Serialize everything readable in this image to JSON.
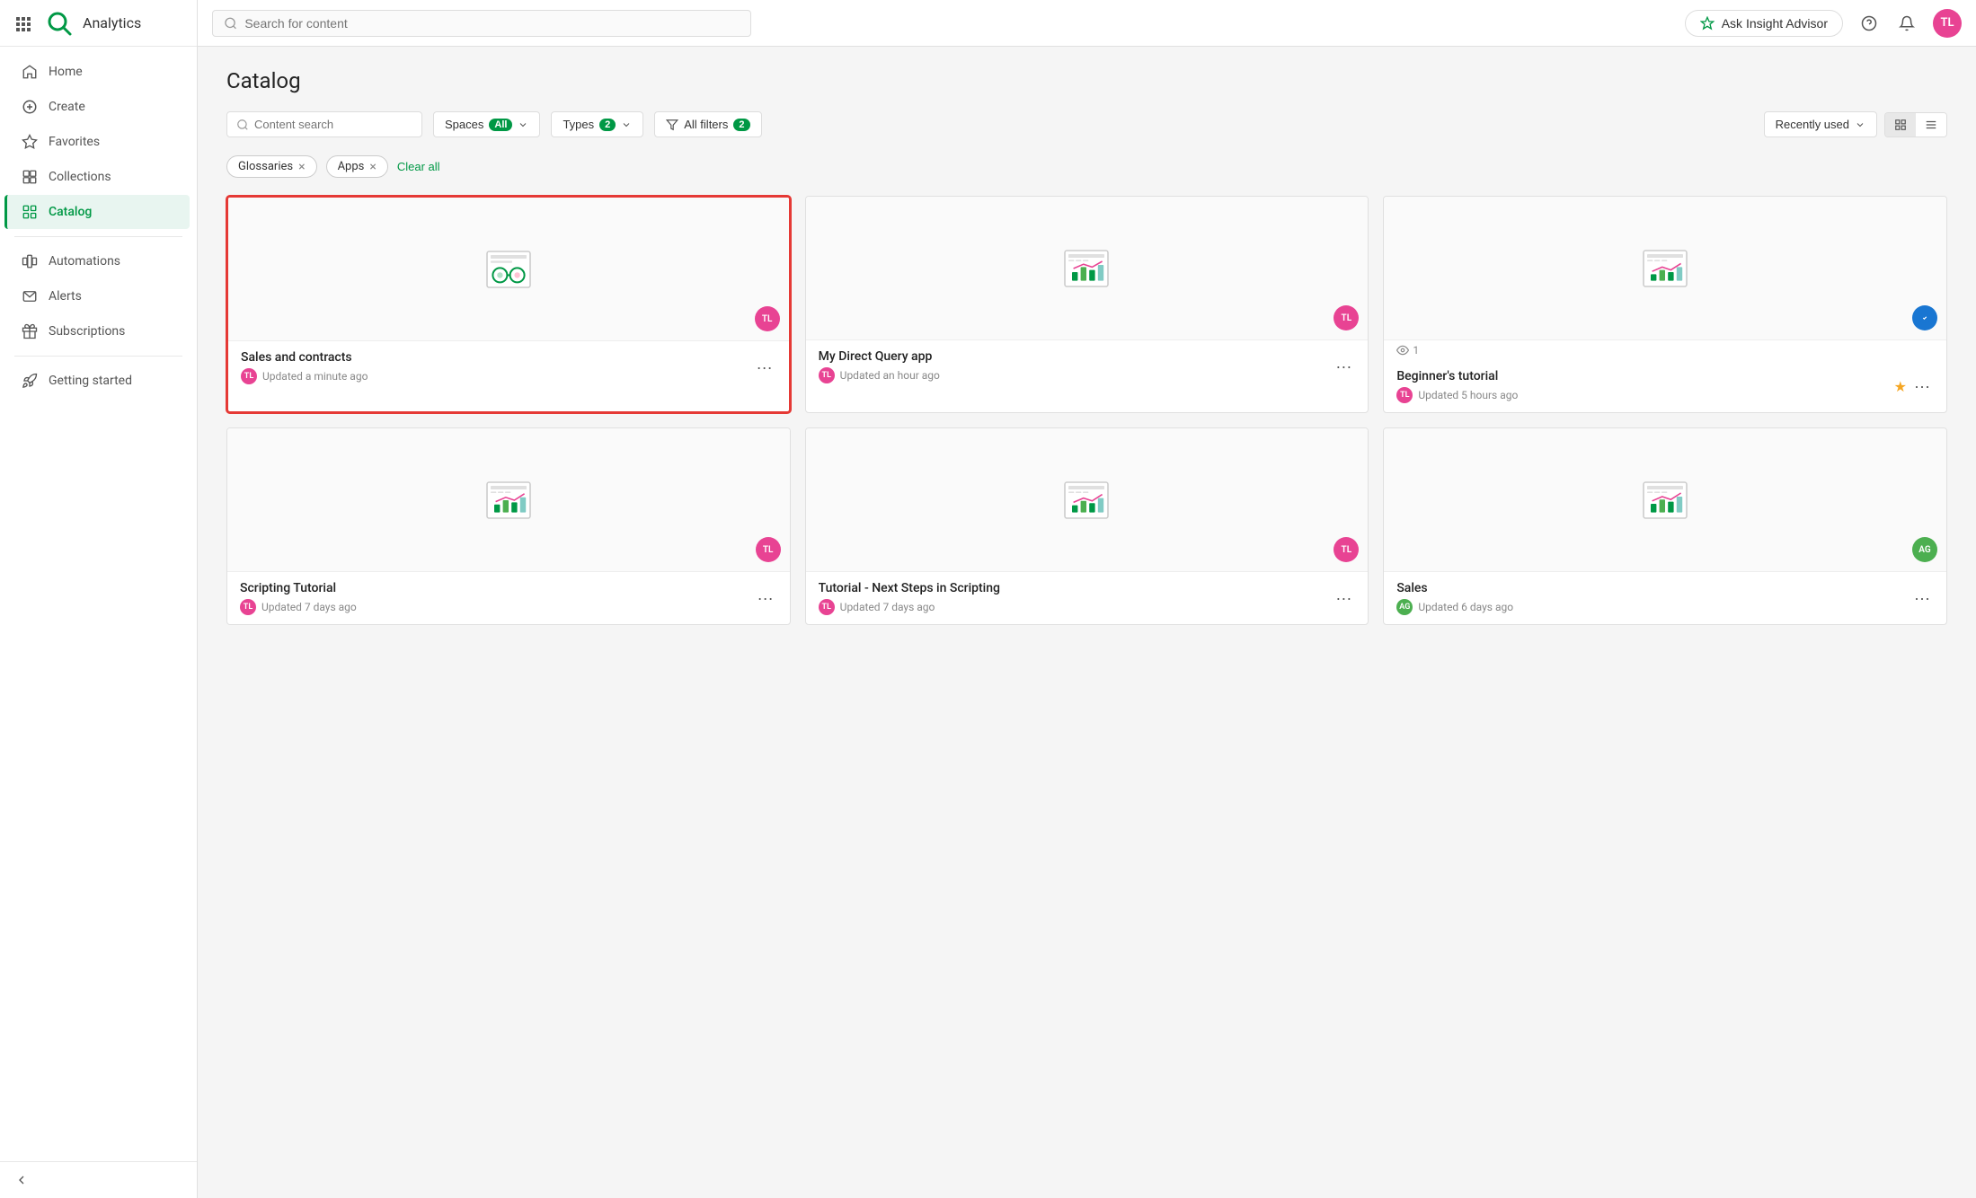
{
  "app": {
    "name": "Analytics",
    "logo_alt": "Qlik"
  },
  "topbar": {
    "search_placeholder": "Search for content",
    "insight_btn": "Ask Insight Advisor",
    "avatar_initials": "TL"
  },
  "sidebar": {
    "items": [
      {
        "id": "home",
        "label": "Home",
        "icon": "home"
      },
      {
        "id": "create",
        "label": "Create",
        "icon": "plus"
      },
      {
        "id": "favorites",
        "label": "Favorites",
        "icon": "star"
      },
      {
        "id": "collections",
        "label": "Collections",
        "icon": "collections"
      },
      {
        "id": "catalog",
        "label": "Catalog",
        "icon": "catalog",
        "active": true
      },
      {
        "id": "automations",
        "label": "Automations",
        "icon": "automations"
      },
      {
        "id": "alerts",
        "label": "Alerts",
        "icon": "alerts"
      },
      {
        "id": "subscriptions",
        "label": "Subscriptions",
        "icon": "subscriptions"
      },
      {
        "id": "getting-started",
        "label": "Getting started",
        "icon": "rocket"
      }
    ],
    "collapse_label": "Collapse"
  },
  "catalog": {
    "title": "Catalog",
    "content_search_placeholder": "Content search",
    "spaces_btn": "Spaces",
    "spaces_value": "All",
    "types_btn": "Types",
    "types_count": 2,
    "all_filters_btn": "All filters",
    "all_filters_count": 2,
    "sort_label": "Recently used",
    "active_chips": [
      {
        "label": "Glossaries",
        "id": "glossaries"
      },
      {
        "label": "Apps",
        "id": "apps"
      }
    ],
    "clear_all": "Clear all",
    "cards": [
      {
        "id": "sales-contracts",
        "title": "Sales and contracts",
        "meta": "Updated a minute ago",
        "avatar": "TL",
        "avatar_type": "tl",
        "icon": "glossary",
        "highlighted": true,
        "views": null,
        "starred": false
      },
      {
        "id": "my-direct-query",
        "title": "My Direct Query app",
        "meta": "Updated an hour ago",
        "avatar": "TL",
        "avatar_type": "tl",
        "icon": "app",
        "highlighted": false,
        "views": null,
        "starred": false
      },
      {
        "id": "beginners-tutorial",
        "title": "Beginner's tutorial",
        "meta": "Updated 5 hours ago",
        "avatar": "TL",
        "avatar_type": "tl",
        "icon": "app",
        "highlighted": false,
        "views": 1,
        "starred": true,
        "badge_type": "blue"
      },
      {
        "id": "scripting-tutorial",
        "title": "Scripting Tutorial",
        "meta": "Updated 7 days ago",
        "avatar": "TL",
        "avatar_type": "tl",
        "icon": "app",
        "highlighted": false,
        "views": null,
        "starred": false
      },
      {
        "id": "tutorial-next-steps",
        "title": "Tutorial - Next Steps in Scripting",
        "meta": "Updated 7 days ago",
        "avatar": "TL",
        "avatar_type": "tl",
        "icon": "app",
        "highlighted": false,
        "views": null,
        "starred": false
      },
      {
        "id": "sales",
        "title": "Sales",
        "meta": "Updated 6 days ago",
        "avatar": "AG",
        "avatar_type": "ag",
        "icon": "app",
        "highlighted": false,
        "views": null,
        "starred": false
      }
    ]
  }
}
